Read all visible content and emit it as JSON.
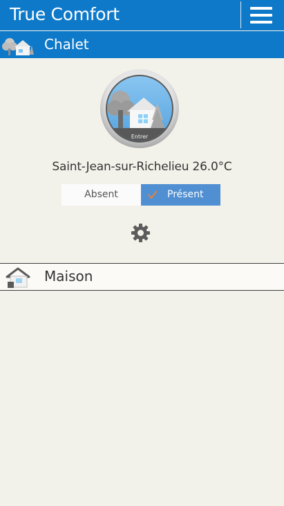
{
  "app": {
    "title": "True Comfort"
  },
  "homes": [
    {
      "name": "Chalet",
      "enter_label": "Entrer",
      "location": "Saint-Jean-sur-Richelieu",
      "temperature": "26.0°C",
      "location_line": "Saint-Jean-sur-Richelieu 26.0°C",
      "mode": {
        "options": [
          "Absent",
          "Présent"
        ],
        "selected": "Présent"
      }
    },
    {
      "name": "Maison"
    }
  ],
  "colors": {
    "header_blue": "#0e79c9",
    "toggle_selected": "#4f8fd2",
    "check_orange": "#e8823a",
    "background": "#f3f2ea"
  }
}
